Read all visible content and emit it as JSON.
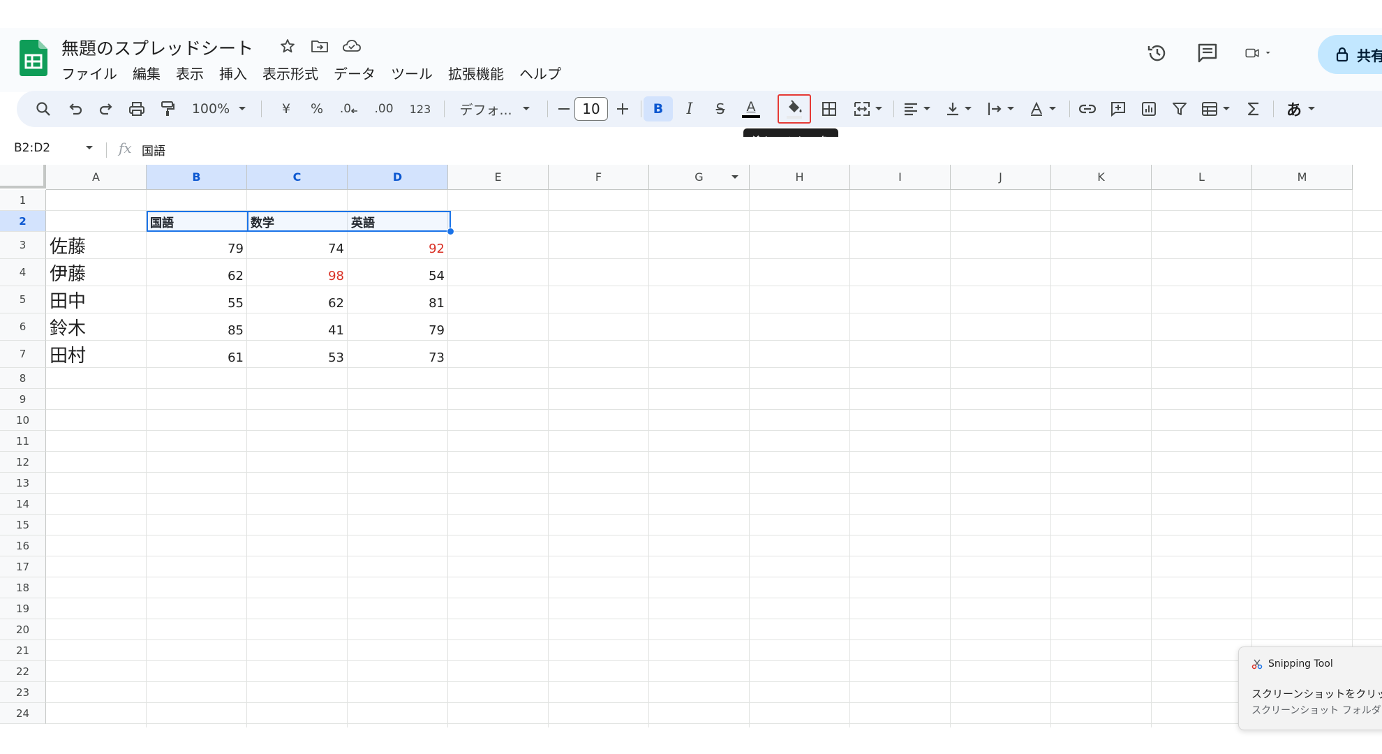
{
  "doc": {
    "title": "無題のスプレッドシート"
  },
  "menu": [
    "ファイル",
    "編集",
    "表示",
    "挿入",
    "表示形式",
    "データ",
    "ツール",
    "拡張機能",
    "ヘルプ"
  ],
  "share": {
    "label": "共有"
  },
  "toolbar": {
    "zoom": "100%",
    "currency": "¥",
    "percent": "%",
    "dec_decrease": ".0",
    "dec_increase": ".00",
    "number_format": "123",
    "font": "デフォ...",
    "font_size": "10",
    "bold": "B",
    "italic": "I",
    "strike": "S",
    "text_color": "A",
    "lang": "あ"
  },
  "tooltip": "塗りつぶしの色",
  "formula_bar": {
    "name_box": "B2:D2",
    "fx": "fx",
    "content": "国語"
  },
  "columns": [
    "A",
    "B",
    "C",
    "D",
    "E",
    "F",
    "G",
    "H",
    "I",
    "J",
    "K",
    "L",
    "M"
  ],
  "rows": [
    "1",
    "2",
    "3",
    "4",
    "5",
    "6",
    "7",
    "8",
    "9",
    "10",
    "11",
    "12",
    "13",
    "14",
    "15",
    "16",
    "17",
    "18",
    "19",
    "20",
    "21",
    "22",
    "23",
    "24"
  ],
  "table": {
    "headers": [
      "国語",
      "数学",
      "英語"
    ],
    "students": [
      {
        "name": "佐藤",
        "scores": [
          "79",
          "74",
          "92"
        ],
        "red": [
          false,
          false,
          true
        ]
      },
      {
        "name": "伊藤",
        "scores": [
          "62",
          "98",
          "54"
        ],
        "red": [
          false,
          true,
          false
        ]
      },
      {
        "name": "田中",
        "scores": [
          "55",
          "62",
          "81"
        ],
        "red": [
          false,
          false,
          false
        ]
      },
      {
        "name": "鈴木",
        "scores": [
          "85",
          "41",
          "79"
        ],
        "red": [
          false,
          false,
          false
        ]
      },
      {
        "name": "田村",
        "scores": [
          "61",
          "53",
          "73"
        ],
        "red": [
          false,
          false,
          false
        ]
      }
    ]
  },
  "colors": {
    "accent": "#1a73e8",
    "highlight_red": "#e53935",
    "score_red": "#d93025",
    "share_bg": "#c2e7ff",
    "toolbar_bg": "#edf2fa"
  },
  "toast": {
    "app": "Snipping Tool",
    "line1": "スクリーンショットをクリップボード",
    "line2": "スクリーンショット フォルダーに自"
  }
}
